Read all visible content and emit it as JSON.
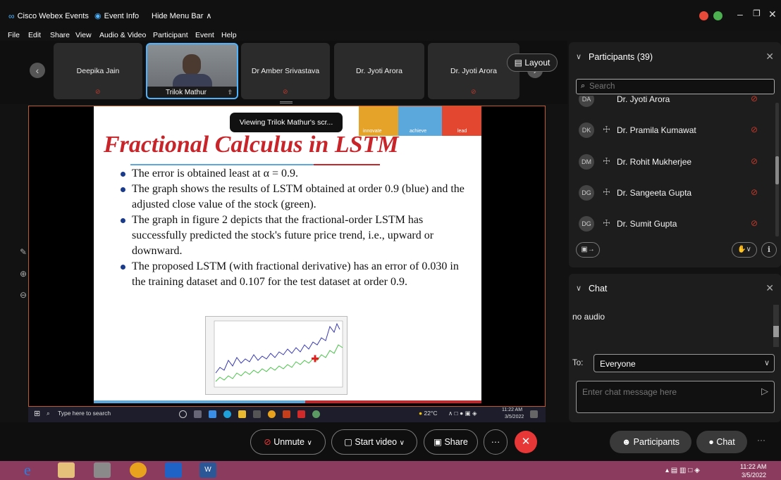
{
  "titlebar": {
    "app_name": "Cisco Webex Events",
    "event_info": "Event Info",
    "hide_menu_bar": "Hide Menu Bar",
    "menu": [
      "File",
      "Edit",
      "Share",
      "View",
      "Audio & Video",
      "Participant",
      "Event",
      "Help"
    ]
  },
  "video_strip": {
    "tiles": [
      "Deepika Jain",
      "Trilok Mathur",
      "Dr Amber Srivastava",
      "Dr. Jyoti Arora",
      "Dr. Jyoti Arora"
    ],
    "layout_label": "Layout"
  },
  "viewing_tag": "Viewing Trilok Mathur's scr...",
  "slide": {
    "band_words": [
      "innovate",
      "achieve",
      "lead"
    ],
    "title": "Fractional Calculus in LSTM",
    "bullets": [
      "The error is obtained least at α = 0.9.",
      "The graph shows the results of LSTM obtained at order 0.9 (blue) and the adjusted close value of the stock (green).",
      "The graph in figure 2 depicts that the fractional-order LSTM has successfully predicted the stock's future price trend, i.e., upward or downward.",
      "The proposed LSTM (with fractional derivative) has an error of 0.030 in the training dataset and 0.107 for the test dataset at order 0.9."
    ]
  },
  "inner_taskbar": {
    "search_placeholder": "Type here to search",
    "weather": "22°C",
    "time": "11:22 AM",
    "date": "3/5/2022"
  },
  "participants_panel": {
    "title": "Participants (39)",
    "search_placeholder": "Search",
    "partial_top": "Dr. Jyoti Arora",
    "rows": [
      {
        "initials": "DK",
        "name": "Dr. Pramila Kumawat"
      },
      {
        "initials": "DM",
        "name": "Dr. Rohit Mukherjee"
      },
      {
        "initials": "DG",
        "name": "Dr. Sangeeta Gupta"
      },
      {
        "initials": "DG",
        "name": "Dr. Sumit Gupta"
      }
    ]
  },
  "chat_panel": {
    "title": "Chat",
    "messages": [
      "no audio"
    ],
    "to_label": "To:",
    "to_value": "Everyone",
    "input_placeholder": "Enter chat message here"
  },
  "controls": {
    "unmute": "Unmute",
    "start_video": "Start video",
    "share": "Share",
    "more": "···",
    "participants": "Participants",
    "chat": "Chat"
  },
  "windows_taskbar": {
    "time": "11:22 AM",
    "date": "3/5/2022"
  },
  "colors": {
    "accent_red": "#e83737",
    "slide_title_red": "#c8252b",
    "taskbar_purple": "#8a3b5e",
    "panel_bg": "#1d1d1d"
  }
}
